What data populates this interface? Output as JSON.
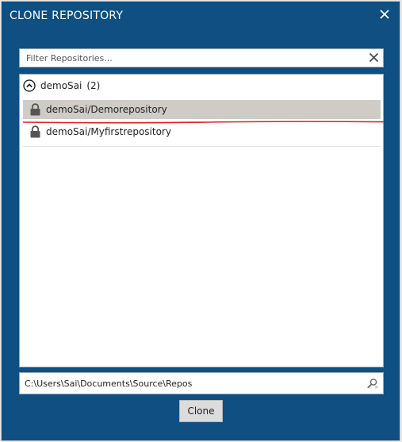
{
  "dialog": {
    "title": "CLONE REPOSITORY"
  },
  "filter": {
    "placeholder": "Filter Repositories...",
    "value": ""
  },
  "group": {
    "label": "demoSai",
    "count": "(2)"
  },
  "repositories": [
    {
      "name": "demoSai/Demorepository",
      "selected": true
    },
    {
      "name": "demoSai/Myfirstrepository",
      "selected": false
    }
  ],
  "path": {
    "value": "C:\\Users\\Sai\\Documents\\Source\\Repos"
  },
  "actions": {
    "clone_label": "Clone"
  },
  "colors": {
    "window": "#0f4f82",
    "selection": "#cfccc7",
    "annotation": "#e02020"
  },
  "icons": [
    "close-icon",
    "clear-filter-icon",
    "collapse-chevron-icon",
    "lock-icon",
    "browse-icon"
  ]
}
